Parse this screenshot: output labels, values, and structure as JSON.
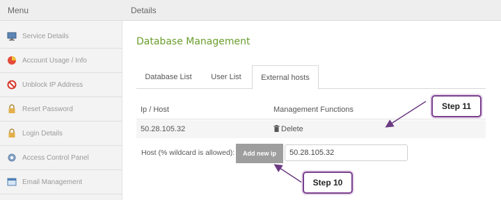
{
  "header": {
    "menu_title": "Menu",
    "details_title": "Details"
  },
  "sidebar": {
    "items": [
      {
        "label": "Service Details",
        "icon": "monitor-icon"
      },
      {
        "label": "Account Usage / Info",
        "icon": "pie-chart-icon"
      },
      {
        "label": "Unblock IP Address",
        "icon": "block-icon"
      },
      {
        "label": "Reset Password",
        "icon": "lock-icon"
      },
      {
        "label": "Login Details",
        "icon": "lock-icon"
      },
      {
        "label": "Access Control Panel",
        "icon": "settings-icon"
      },
      {
        "label": "Email Management",
        "icon": "window-icon"
      }
    ]
  },
  "main": {
    "title": "Database Management",
    "tabs": [
      {
        "label": "Database List"
      },
      {
        "label": "User List"
      },
      {
        "label": "External hosts",
        "active": true
      }
    ],
    "table": {
      "headers": [
        "Ip / Host",
        "Management Functions"
      ],
      "rows": [
        {
          "ip": "50.28.105.32",
          "action": "Delete"
        }
      ]
    },
    "host_form": {
      "label": "Host (% wildcard is allowed):",
      "button_label": "Add new ip",
      "input_value": "50.28.105.32"
    }
  },
  "callouts": {
    "step11": "Step 11",
    "step10": "Step 10"
  },
  "colors": {
    "title_green": "#6a9d2d",
    "callout_border": "#7a3e8e",
    "button_gray": "#9e9e9e"
  }
}
